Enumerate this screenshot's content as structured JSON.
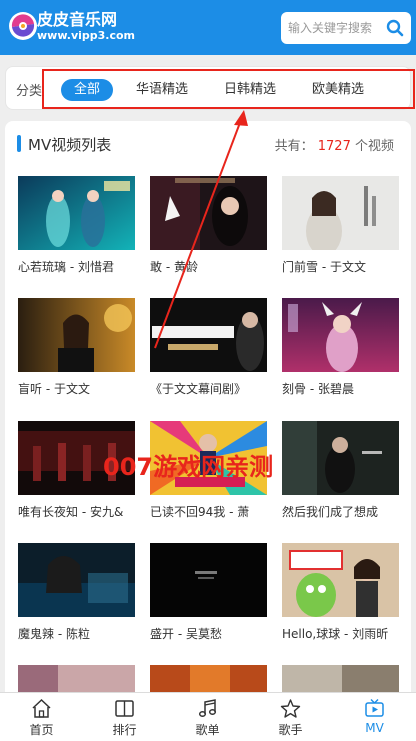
{
  "header": {
    "site_name": "皮皮音乐网",
    "site_url": "www.vipp3.com",
    "search_placeholder": "输入关键字搜索"
  },
  "category": {
    "label": "分类",
    "tabs": [
      "全部",
      "华语精选",
      "日韩精选",
      "欧美精选"
    ],
    "active": "全部"
  },
  "list": {
    "title": "MV视频列表",
    "count_prefix": "共有：",
    "count": "1727",
    "count_suffix": "个视频",
    "items": [
      {
        "title": "心若琉璃 - 刘惜君"
      },
      {
        "title": "敢 - 黄龄"
      },
      {
        "title": "门前雪 - 于文文"
      },
      {
        "title": "盲听 - 于文文"
      },
      {
        "title": "《于文文幕间剧》"
      },
      {
        "title": "刻骨 - 张碧晨"
      },
      {
        "title": "唯有长夜知 - 安九&"
      },
      {
        "title": "已读不回94我 - 萧"
      },
      {
        "title": "然后我们成了想成"
      },
      {
        "title": "魔鬼辣 - 陈粒"
      },
      {
        "title": "盛开 - 吴莫愁"
      },
      {
        "title": "Hello,球球 - 刘雨昕"
      }
    ]
  },
  "watermark": "007游戏网亲测",
  "bottom_nav": {
    "items": [
      {
        "label": "首页",
        "icon": "home-icon"
      },
      {
        "label": "排行",
        "icon": "book-icon"
      },
      {
        "label": "歌单",
        "icon": "music-note-icon"
      },
      {
        "label": "歌手",
        "icon": "star-icon"
      },
      {
        "label": "MV",
        "icon": "tv-play-icon"
      }
    ],
    "active": "MV",
    "active_color": "#1c8de6"
  },
  "colors": {
    "primary": "#1c8de6",
    "highlight": "#e8251c"
  }
}
